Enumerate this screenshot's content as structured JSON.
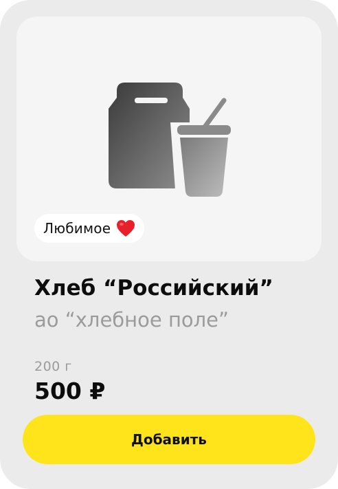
{
  "product": {
    "badge_label": "Любимое",
    "badge_icon": "heart-icon",
    "title": "Хлеб “Российский”",
    "producer": "ао “хлебное поле”",
    "weight": "200 г",
    "price": "500 ₽",
    "image_icon": "takeaway-bag-and-cup-icon"
  },
  "actions": {
    "add_label": "Добавить"
  },
  "colors": {
    "card_background": "#ebebeb",
    "image_background": "#f5f5f5",
    "button_accent": "#ffe41b",
    "heart": "#e8202a",
    "secondary_text": "#9b9b9b"
  }
}
